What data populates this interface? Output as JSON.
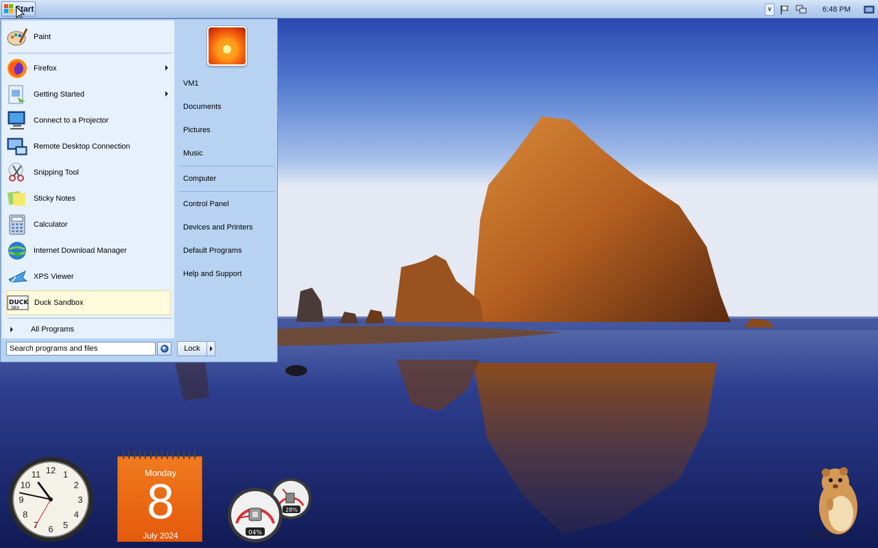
{
  "taskbar": {
    "start_label": "Start",
    "time": "6:48 PM"
  },
  "start_menu": {
    "pinned": [
      {
        "label": "Paint",
        "icon": "paint-icon"
      }
    ],
    "programs": [
      {
        "label": "Firefox",
        "icon": "firefox-icon",
        "has_submenu": true
      },
      {
        "label": "Getting Started",
        "icon": "getting-started-icon",
        "has_submenu": true
      },
      {
        "label": "Connect to a Projector",
        "icon": "projector-icon",
        "has_submenu": false
      },
      {
        "label": "Remote Desktop Connection",
        "icon": "remote-desktop-icon",
        "has_submenu": false
      },
      {
        "label": "Snipping Tool",
        "icon": "scissors-icon",
        "has_submenu": false
      },
      {
        "label": "Sticky Notes",
        "icon": "sticky-notes-icon",
        "has_submenu": false
      },
      {
        "label": "Calculator",
        "icon": "calculator-icon",
        "has_submenu": false
      },
      {
        "label": "Internet Download Manager",
        "icon": "download-manager-icon",
        "has_submenu": false
      },
      {
        "label": "XPS Viewer",
        "icon": "xps-viewer-icon",
        "has_submenu": false
      },
      {
        "label": "Duck Sandbox",
        "icon": "duck-sandbox-icon",
        "has_submenu": false,
        "highlighted": true
      }
    ],
    "all_programs": "All Programs",
    "search_placeholder": "Search programs and files",
    "places_group1": [
      "VM1",
      "Documents",
      "Pictures",
      "Music"
    ],
    "places_group2": [
      "Computer"
    ],
    "places_group3": [
      "Control Panel",
      "Devices and Printers",
      "Default Programs",
      "Help and Support"
    ],
    "lock_label": "Lock"
  },
  "gadgets": {
    "clock": {
      "hour": 10,
      "minute": 47,
      "second": 35
    },
    "calendar": {
      "weekday": "Monday",
      "date": "8",
      "month_year": "July 2024"
    },
    "cpu_meter": {
      "cpu": "04%",
      "memory": "28%"
    }
  },
  "colors": {
    "taskbar": "#b9d1ef",
    "menu_bg": "#e7f1fc",
    "highlight": "#fffbdc",
    "calendar": "#e8620f"
  }
}
